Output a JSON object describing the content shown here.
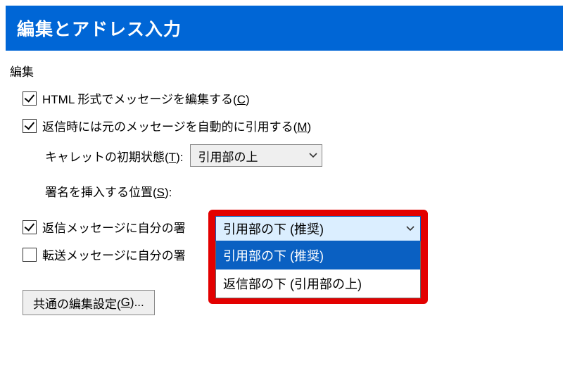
{
  "banner": {
    "title": "編集とアドレス入力"
  },
  "group": {
    "edit_label": "編集"
  },
  "checkboxes": {
    "html": {
      "label_a": "HTML 形式でメッセージを編集する(",
      "accel": "C",
      "label_b": ")",
      "checked": true
    },
    "auto_quote": {
      "label_a": "返信時には元のメッセージを自動的に引用する(",
      "accel": "M",
      "label_b": ")",
      "checked": true
    },
    "reply_sig": {
      "label_a": "返信メッセージに自分の署",
      "checked": true
    },
    "forward_sig": {
      "label_a": "転送メッセージに自分の署",
      "checked": false
    }
  },
  "caret": {
    "label_a": "キャレットの初期状態(",
    "accel": "T",
    "label_b": "):",
    "value": "引用部の上"
  },
  "sig_pos": {
    "label_a": "署名を挿入する位置(",
    "accel": "S",
    "label_b": "):",
    "selected": "引用部の下 (推奨)",
    "options": [
      "引用部の下 (推奨)",
      "返信部の下 (引用部の上)"
    ]
  },
  "common_btn": {
    "label_a": "共通の編集設定(",
    "accel": "G",
    "label_b": ")..."
  }
}
